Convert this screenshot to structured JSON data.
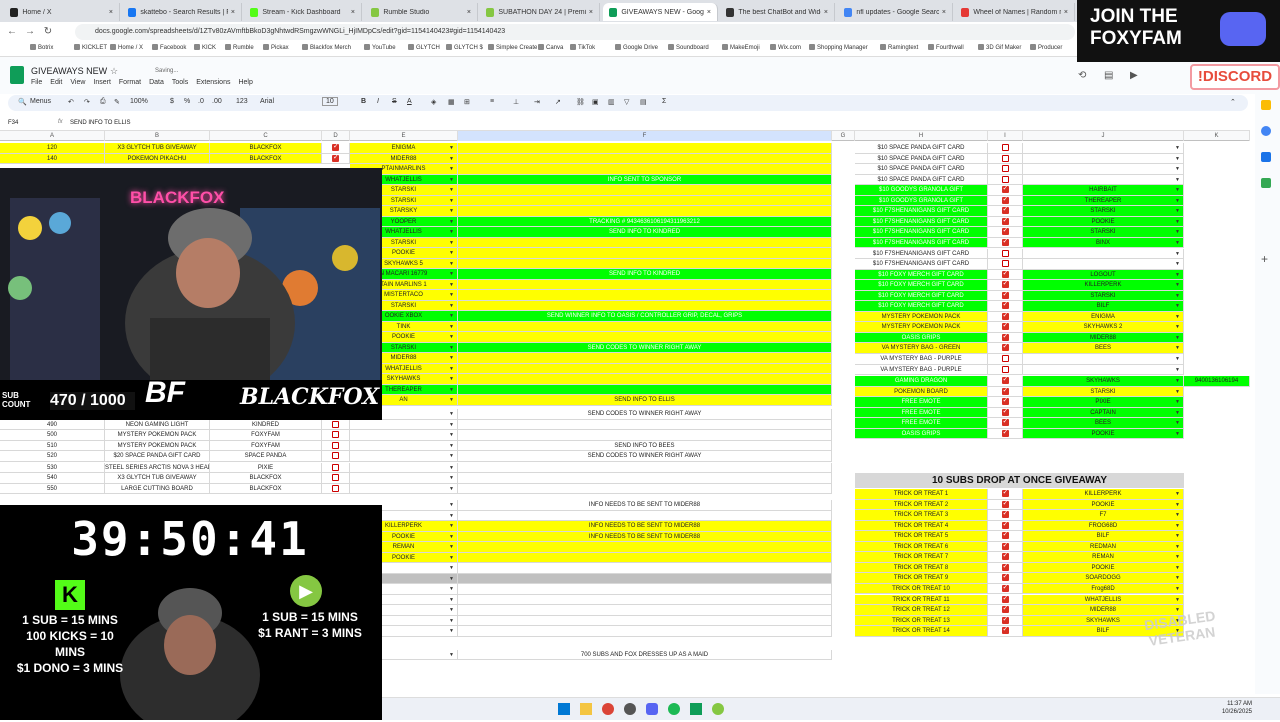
{
  "tabs": [
    {
      "label": "Home / X",
      "color": "#222"
    },
    {
      "label": "skattebo - Search Results | Face",
      "color": "#1877f2"
    },
    {
      "label": "Stream - Kick Dashboard",
      "color": "#53fc18"
    },
    {
      "label": "Rumble Studio",
      "color": "#85c742"
    },
    {
      "label": "SUBATHON DAY 24 | Premi...",
      "color": "#85c742"
    },
    {
      "label": "GIVEAWAYS NEW - Google She...",
      "color": "#0f9d58"
    },
    {
      "label": "The best ChatBot and Widgets",
      "color": "#333"
    },
    {
      "label": "nfl updates - Google Search",
      "color": "#4285f4"
    },
    {
      "label": "Wheel of Names | Random nam",
      "color": "#e53935"
    }
  ],
  "url": "docs.google.com/spreadsheets/d/1ZTv80zAVmftbBkoD3gNhtwdRSmgzwWNGLi_HjIMDpCs/edit?gid=1154140423#gid=1154140423",
  "bookmarks": [
    "Botrix",
    "KICKLET",
    "Home / X",
    "Facebook",
    "KICK",
    "Rumble",
    "Pickax",
    "Blackfox Merch",
    "YouTube",
    "GLYTCH",
    "GLYTCH $",
    "Simplee Create",
    "Canva",
    "TikTok",
    "Google Drive",
    "Soundboard",
    "MakeEmoji",
    "Wix.com",
    "Shopping Manager",
    "Ramingtext",
    "Fourthwall",
    "3D Gif Maker",
    "Producer"
  ],
  "doc": {
    "title": "GIVEAWAYS NEW",
    "saving": "Saving...",
    "menu": [
      "File",
      "Edit",
      "View",
      "Insert",
      "Format",
      "Data",
      "Tools",
      "Extensions",
      "Help"
    ]
  },
  "toolbar": {
    "menus": "Menus",
    "zoom": "100%",
    "currency": "$",
    "percent": "%",
    "dec1": ".0",
    "dec2": ".00",
    "numfmt": "123",
    "font": "Arial",
    "size": "10",
    "bold": "B",
    "italic": "I",
    "strike": "S",
    "textcolor": "A"
  },
  "formula": {
    "cellref": "F34",
    "content": "SEND INFO TO ELLIS"
  },
  "columns": [
    "A",
    "B",
    "C",
    "D",
    "E",
    "F",
    "G",
    "H",
    "I",
    "J",
    "K"
  ],
  "stream": {
    "subcount_label": "SUB COUNT",
    "subcount": "470 / 1000",
    "logo": "BLACKFOX",
    "neon": "BLACKFOX",
    "timer": "39:50:41",
    "kick_rates": [
      "1 SUB = 15 MINS",
      "100 KICKS = 10 MINS",
      "$1 DONO = 3 MINS"
    ],
    "rumble_rates": [
      "1 SUB = 15 MINS",
      "$1 RANT = 3 MINS"
    ],
    "join": "JOIN THE FOXYFAM",
    "discord": "!DISCORD",
    "veteran": "DISABLED VETERAN"
  },
  "left_rows": [
    {
      "num": "10",
      "a": "120",
      "b": "X3 GLYTCH TUB GIVEAWAY",
      "c": "BLACKFOX",
      "checked": true,
      "e": "ENIGMA",
      "f": "",
      "fill": "y"
    },
    {
      "num": "11",
      "a": "140",
      "b": "POKEMON PIKACHU",
      "c": "BLACKFOX",
      "checked": true,
      "e": "MIDER88",
      "f": "",
      "fill": "y"
    }
  ],
  "visible_rows": [
    {
      "num": "",
      "e": "PTAINMARLINS",
      "f": "",
      "fill": "y"
    },
    {
      "num": "",
      "e": "WHATJELLIS",
      "f": "INFO SENT TO SPONSOR",
      "fill": "g"
    },
    {
      "num": "",
      "e": "STARSKI",
      "f": "",
      "fill": "y"
    },
    {
      "num": "",
      "e": "STARSKI",
      "f": "",
      "fill": "y"
    },
    {
      "num": "",
      "e": "STARSKY",
      "f": "",
      "fill": "y"
    },
    {
      "num": "",
      "e": "YOOPER",
      "f": "TRACKING # 9434636106194311963212",
      "fill": "g"
    },
    {
      "num": "",
      "e": "WHATJELLIS",
      "f": "SEND INFO TO KINDRED",
      "fill": "g"
    },
    {
      "num": "",
      "e": "STARSKI",
      "f": "",
      "fill": "y"
    },
    {
      "num": "",
      "e": "POOKIE",
      "f": "",
      "fill": "y"
    },
    {
      "num": "",
      "e": "SKYHAWKS 5",
      "f": "",
      "fill": "y"
    },
    {
      "num": "",
      "e": "N MACARI 16779",
      "f": "SEND INFO TO KINDRED",
      "fill": "g"
    },
    {
      "num": "",
      "e": "TAIN MARLINS 1",
      "f": "",
      "fill": "y"
    },
    {
      "num": "",
      "e": "MISTERTACO",
      "f": "",
      "fill": "y"
    },
    {
      "num": "",
      "e": "STARSKI",
      "f": "",
      "fill": "y"
    },
    {
      "num": "",
      "e": "OOKIE XBOX",
      "f": "SEND WINNER INFO TO OASIS / CONTROLLER GRIP, DECAL, GRIPS",
      "fill": "g"
    },
    {
      "num": "",
      "e": "TINK",
      "f": "",
      "fill": "y"
    },
    {
      "num": "",
      "e": "POOKIE",
      "f": "",
      "fill": "y"
    },
    {
      "num": "",
      "e": "STARSKI",
      "f": "SEND CODES TO WINNER RIGHT AWAY",
      "fill": "g"
    },
    {
      "num": "",
      "e": "MIDER88",
      "f": "",
      "fill": "y"
    },
    {
      "num": "",
      "e": "WHATJELLIS",
      "f": "",
      "fill": "y"
    },
    {
      "num": "",
      "e": "SKYHAWKS",
      "f": "",
      "fill": "y"
    },
    {
      "num": "",
      "e": "THEREAPER",
      "f": "",
      "fill": "g"
    },
    {
      "num": "",
      "e": "AN",
      "f": "SEND INFO TO ELLIS",
      "fill": "y"
    }
  ],
  "lower_rows": [
    {
      "num": "",
      "a": "",
      "b": "",
      "c": "",
      "checked": false,
      "e": "",
      "f": "SEND CODES TO WINNER RIGHT AWAY",
      "fill": ""
    },
    {
      "num": "36",
      "a": "490",
      "b": "NEON GAMING LIGHT",
      "c": "KINDRED",
      "checked": false,
      "e": "",
      "f": "",
      "fill": ""
    },
    {
      "num": "37",
      "a": "500",
      "b": "MYSTERY POKEMON PACK",
      "c": "FOXYFAM",
      "checked": false,
      "e": "",
      "f": "",
      "fill": ""
    },
    {
      "num": "38",
      "a": "510",
      "b": "MYSTERY POKEMON PACK",
      "c": "FOXYFAM",
      "checked": false,
      "e": "",
      "f": "SEND INFO TO BEES",
      "fill": ""
    },
    {
      "num": "39",
      "a": "520",
      "b": "$20 SPACE PANDA GIFT CARD",
      "c": "SPACE PANDA",
      "checked": false,
      "e": "",
      "f": "SEND CODES TO WINNER RIGHT AWAY",
      "fill": ""
    },
    {
      "num": "40",
      "a": "530",
      "b": "STEEL SERIES ARCTIS NOVA 3 HEADPHONES",
      "c": "PIXIE",
      "checked": false,
      "e": "",
      "f": "",
      "fill": ""
    },
    {
      "num": "41",
      "a": "540",
      "b": "X3 GLYTCH TUB GIVEAWAY",
      "c": "BLACKFOX",
      "checked": false,
      "e": "",
      "f": "",
      "fill": ""
    },
    {
      "num": "42",
      "a": "550",
      "b": "LARGE CUTTING BOARD",
      "c": "BLACKFOX",
      "checked": false,
      "e": "",
      "f": "",
      "fill": ""
    }
  ],
  "bottom_rows": [
    {
      "e": "",
      "f": "INFO NEEDS TO BE SENT TO MIDER88",
      "fill": ""
    },
    {
      "e": "",
      "f": "",
      "fill": ""
    },
    {
      "e": "KILLERPERK",
      "f": "INFO NEEDS TO BE SENT TO MIDER88",
      "fill": "y"
    },
    {
      "e": "POOKIE",
      "f": "INFO NEEDS TO BE SENT TO MIDER88",
      "fill": "y"
    },
    {
      "e": "REMAN",
      "f": "",
      "fill": "y"
    },
    {
      "e": "POOKIE",
      "f": "",
      "fill": "y"
    },
    {
      "e": "",
      "f": "",
      "fill": ""
    },
    {
      "e": "",
      "f": "",
      "fill": "gr"
    },
    {
      "e": "",
      "f": "",
      "fill": ""
    },
    {
      "e": "",
      "f": "",
      "fill": ""
    },
    {
      "e": "",
      "f": "",
      "fill": ""
    },
    {
      "e": "",
      "f": "",
      "fill": ""
    },
    {
      "e": "",
      "f": "",
      "fill": ""
    },
    {
      "e": "",
      "f": "700 SUBS AND FOX DRESSES UP AS A MAID",
      "fill": ""
    }
  ],
  "prize_rows": [
    {
      "h": "$10 SPACE PANDA GIFT CARD",
      "checked": false,
      "j": "",
      "fill": ""
    },
    {
      "h": "$10 SPACE PANDA GIFT CARD",
      "checked": false,
      "j": "",
      "fill": ""
    },
    {
      "h": "$10 SPACE PANDA GIFT CARD",
      "checked": false,
      "j": "",
      "fill": ""
    },
    {
      "h": "$10 SPACE PANDA GIFT CARD",
      "checked": false,
      "j": "",
      "fill": ""
    },
    {
      "h": "$10 GOODYS GRANOLA GIFT",
      "checked": true,
      "j": "HAIRBAIT",
      "fill": "g"
    },
    {
      "h": "$10 GOODYS GRANOLA GIFT",
      "checked": true,
      "j": "THEREAPER",
      "fill": "g"
    },
    {
      "h": "$10 F7SHENANIGANS GIFT CARD",
      "checked": true,
      "j": "STARSKI",
      "fill": "g"
    },
    {
      "h": "$10 F7SHENANIGANS GIFT CARD",
      "checked": true,
      "j": "POOKIE",
      "fill": "g"
    },
    {
      "h": "$10 F7SHENANIGANS GIFT CARD",
      "checked": true,
      "j": "STARSKI",
      "fill": "g"
    },
    {
      "h": "$10 F7SHENANIGANS GIFT CARD",
      "checked": true,
      "j": "BINX",
      "fill": "g"
    },
    {
      "h": "$10 F7SHENANIGANS GIFT CARD",
      "checked": false,
      "j": "",
      "fill": ""
    },
    {
      "h": "$10 F7SHENANIGANS GIFT CARD",
      "checked": false,
      "j": "",
      "fill": ""
    },
    {
      "h": "$10 FOXY MERCH GIFT CARD",
      "checked": true,
      "j": "LOGOUT",
      "fill": "g"
    },
    {
      "h": "$10 FOXY MERCH GIFT CARD",
      "checked": true,
      "j": "KILLERPERK",
      "fill": "g"
    },
    {
      "h": "$10 FOXY MERCH GIFT CARD",
      "checked": true,
      "j": "STARSKI",
      "fill": "g"
    },
    {
      "h": "$10 FOXY MERCH GIFT CARD",
      "checked": true,
      "j": "BILF",
      "fill": "g"
    },
    {
      "h": "MYSTERY POKEMON PACK",
      "checked": true,
      "j": "ENIGMA",
      "fill": "y"
    },
    {
      "h": "MYSTERY POKEMON PACK",
      "checked": true,
      "j": "SKYHAWKS 2",
      "fill": "y"
    },
    {
      "h": "OASIS GRIPS",
      "checked": true,
      "j": "MIDER88",
      "fill": "g"
    },
    {
      "h": "VA MYSTERY BAG - GREEN",
      "checked": true,
      "j": "BEES",
      "fill": "y"
    },
    {
      "h": "VA MYSTERY BAG - PURPLE",
      "checked": false,
      "j": "",
      "fill": ""
    },
    {
      "h": "VA MYSTERY BAG - PURPLE",
      "checked": false,
      "j": "",
      "fill": ""
    },
    {
      "h": "GAMING DRAGON",
      "checked": true,
      "j": "SKYHAWKS",
      "fill": "g"
    },
    {
      "h": "POKEMON BOARD",
      "checked": true,
      "j": "STARSKI",
      "fill": "y"
    },
    {
      "h": "FREE EMOTE",
      "checked": true,
      "j": "PIXIE",
      "fill": "g"
    },
    {
      "h": "FREE EMOTE",
      "checked": true,
      "j": "CAPTAIN",
      "fill": "g"
    },
    {
      "h": "FREE EMOTE",
      "checked": true,
      "j": "BEES",
      "fill": "g"
    },
    {
      "h": "OASIS GRIPS",
      "checked": true,
      "j": "POOKIE",
      "fill": "g"
    }
  ],
  "gaming_dragon_k": "9400136106194",
  "giveaway_title": "10 SUBS DROP AT ONCE GIVEAWAY",
  "trick_rows": [
    {
      "h": "TRICK OR TREAT 1",
      "checked": true,
      "j": "KILLERPERK"
    },
    {
      "h": "TRICK OR TREAT 2",
      "checked": true,
      "j": "POOKIE"
    },
    {
      "h": "TRICK OR TREAT 3",
      "checked": true,
      "j": "F7"
    },
    {
      "h": "TRICK OR TREAT 4",
      "checked": true,
      "j": "FROG68D"
    },
    {
      "h": "TRICK OR TREAT 5",
      "checked": true,
      "j": "BILF"
    },
    {
      "h": "TRICK OR TREAT 6",
      "checked": true,
      "j": "REDMAN"
    },
    {
      "h": "TRICK OR TREAT 7",
      "checked": true,
      "j": "REMAN"
    },
    {
      "h": "TRICK OR TREAT 8",
      "checked": true,
      "j": "POOKIE"
    },
    {
      "h": "TRICK OR TREAT 9",
      "checked": true,
      "j": "SOARDOGG"
    },
    {
      "h": "TRICK OR TREAT 10",
      "checked": true,
      "j": "Frog68D"
    },
    {
      "h": "TRICK OR TREAT 11",
      "checked": true,
      "j": "WHATJELLIS"
    },
    {
      "h": "TRICK OR TREAT 12",
      "checked": true,
      "j": "MIDER88"
    },
    {
      "h": "TRICK OR TREAT 13",
      "checked": true,
      "j": "SKYHAWKS"
    },
    {
      "h": "TRICK OR TREAT 14",
      "checked": true,
      "j": "BILF"
    }
  ],
  "clock": {
    "time": "11:37 AM",
    "date": "10/26/2025"
  }
}
